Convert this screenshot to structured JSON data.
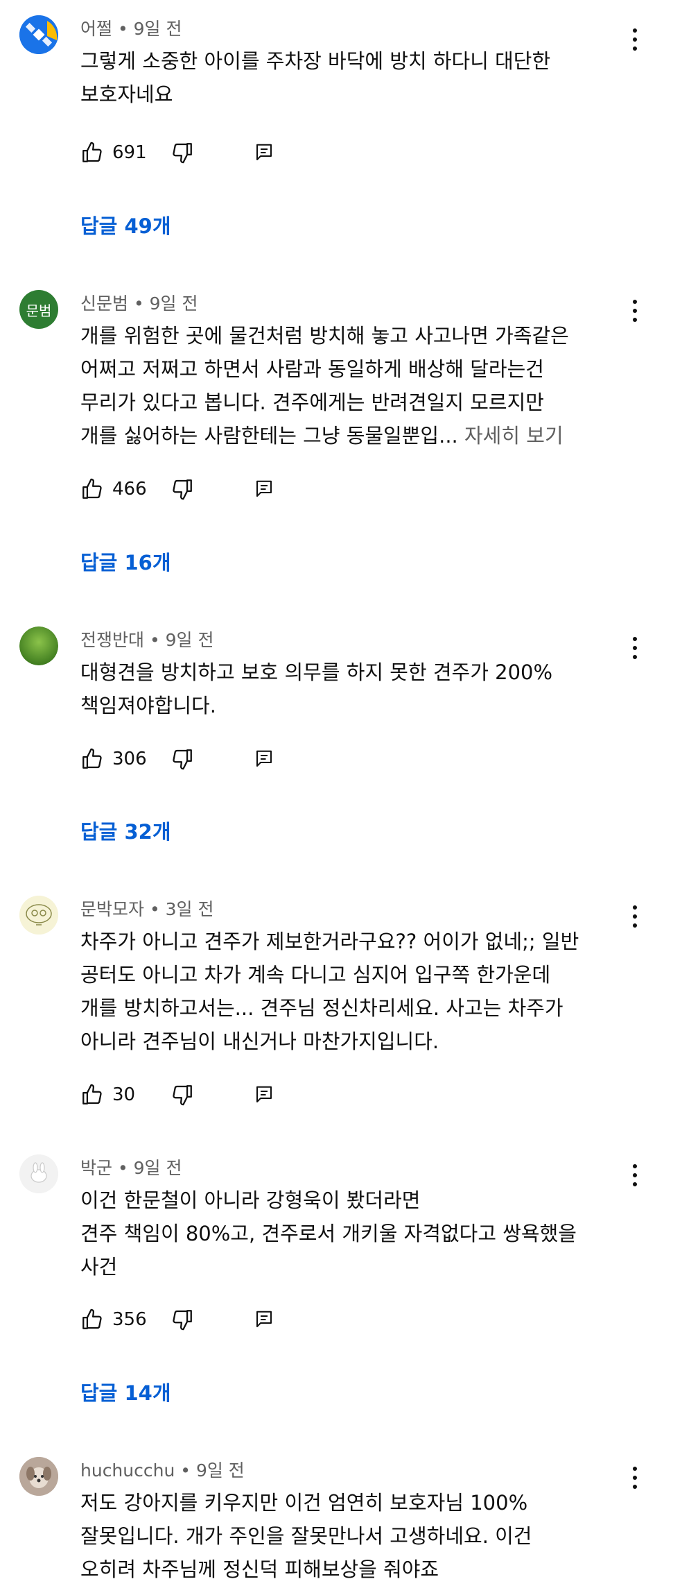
{
  "comments": [
    {
      "author": "어쩔",
      "time": "9일 전",
      "text": "그렇게 소중한 아이를 주차장 바닥에 방치 하다니 대단한\n보호자네요",
      "more": "",
      "likes": "691",
      "replies": "답글 49개",
      "avatar": {
        "icon": "satellite-icon",
        "color": "#1a73e8"
      }
    },
    {
      "author": "신문범",
      "time": "9일 전",
      "text": "개를 위험한 곳에 물건처럼 방치해 놓고 사고나면 가족같은\n어쩌고 저쩌고 하면서 사람과 동일하게 배상해 달라는건\n무리가 있다고 봅니다. 견주에게는 반려견일지 모르지만\n개를 싫어하는 사람한테는 그냥 동물일뿐입... ",
      "more": "자세히 보기",
      "likes": "466",
      "replies": "답글 16개",
      "avatar": {
        "label": "문범",
        "color": "#2e7d32"
      }
    },
    {
      "author": "전쟁반대",
      "time": "9일 전",
      "text": "대형견을 방치하고 보호 의무를 하지 못한 견주가 200%\n책임져야합니다.",
      "more": "",
      "likes": "306",
      "replies": "답글 32개",
      "avatar": {
        "icon": "grass-photo",
        "color": "#5f9a2c"
      }
    },
    {
      "author": "문박모자",
      "time": "3일 전",
      "text": "차주가 아니고 견주가 제보한거라구요?? 어이가 없네;; 일반\n공터도 아니고 차가 계속 다니고 심지어 입구쪽 한가운데\n개를 방치하고서는... 견주님 정신차리세요. 사고는 차주가\n아니라 견주님이 내신거나 마찬가지입니다.",
      "more": "",
      "likes": "30",
      "replies": "",
      "avatar": {
        "icon": "cartoon-face-icon",
        "color": "#f6f3d6"
      }
    },
    {
      "author": "박군",
      "time": "9일 전",
      "text": "이건 한문철이 아니라 강형욱이 봤더라면\n견주 책임이 80%고, 견주로서 개키울 자격없다고 쌍욕했을\n사건",
      "more": "",
      "likes": "356",
      "replies": "답글 14개",
      "avatar": {
        "icon": "rabbit-icon",
        "color": "#f2f2f2"
      }
    },
    {
      "author": "huchucchu",
      "time": "9일 전",
      "text": "저도 강아지를 키우지만 이건 엄연히 보호자님 100%\n잘못입니다. 개가 주인을 잘못만나서 고생하네요. 이건\n오히려 차주님께 정신덕 피해보상을 줘야죠",
      "more": "",
      "likes": "",
      "replies": "",
      "avatar": {
        "icon": "puppy-photo",
        "color": "#b9a79a"
      }
    }
  ],
  "icons": {
    "like": "thumbs-up-icon",
    "dislike": "thumbs-down-icon",
    "reply": "reply-comment-icon",
    "menu": "more-vertical-icon"
  },
  "colors": {
    "reply_link": "#065fd4",
    "meta": "#606060",
    "text": "#0f0f0f"
  }
}
